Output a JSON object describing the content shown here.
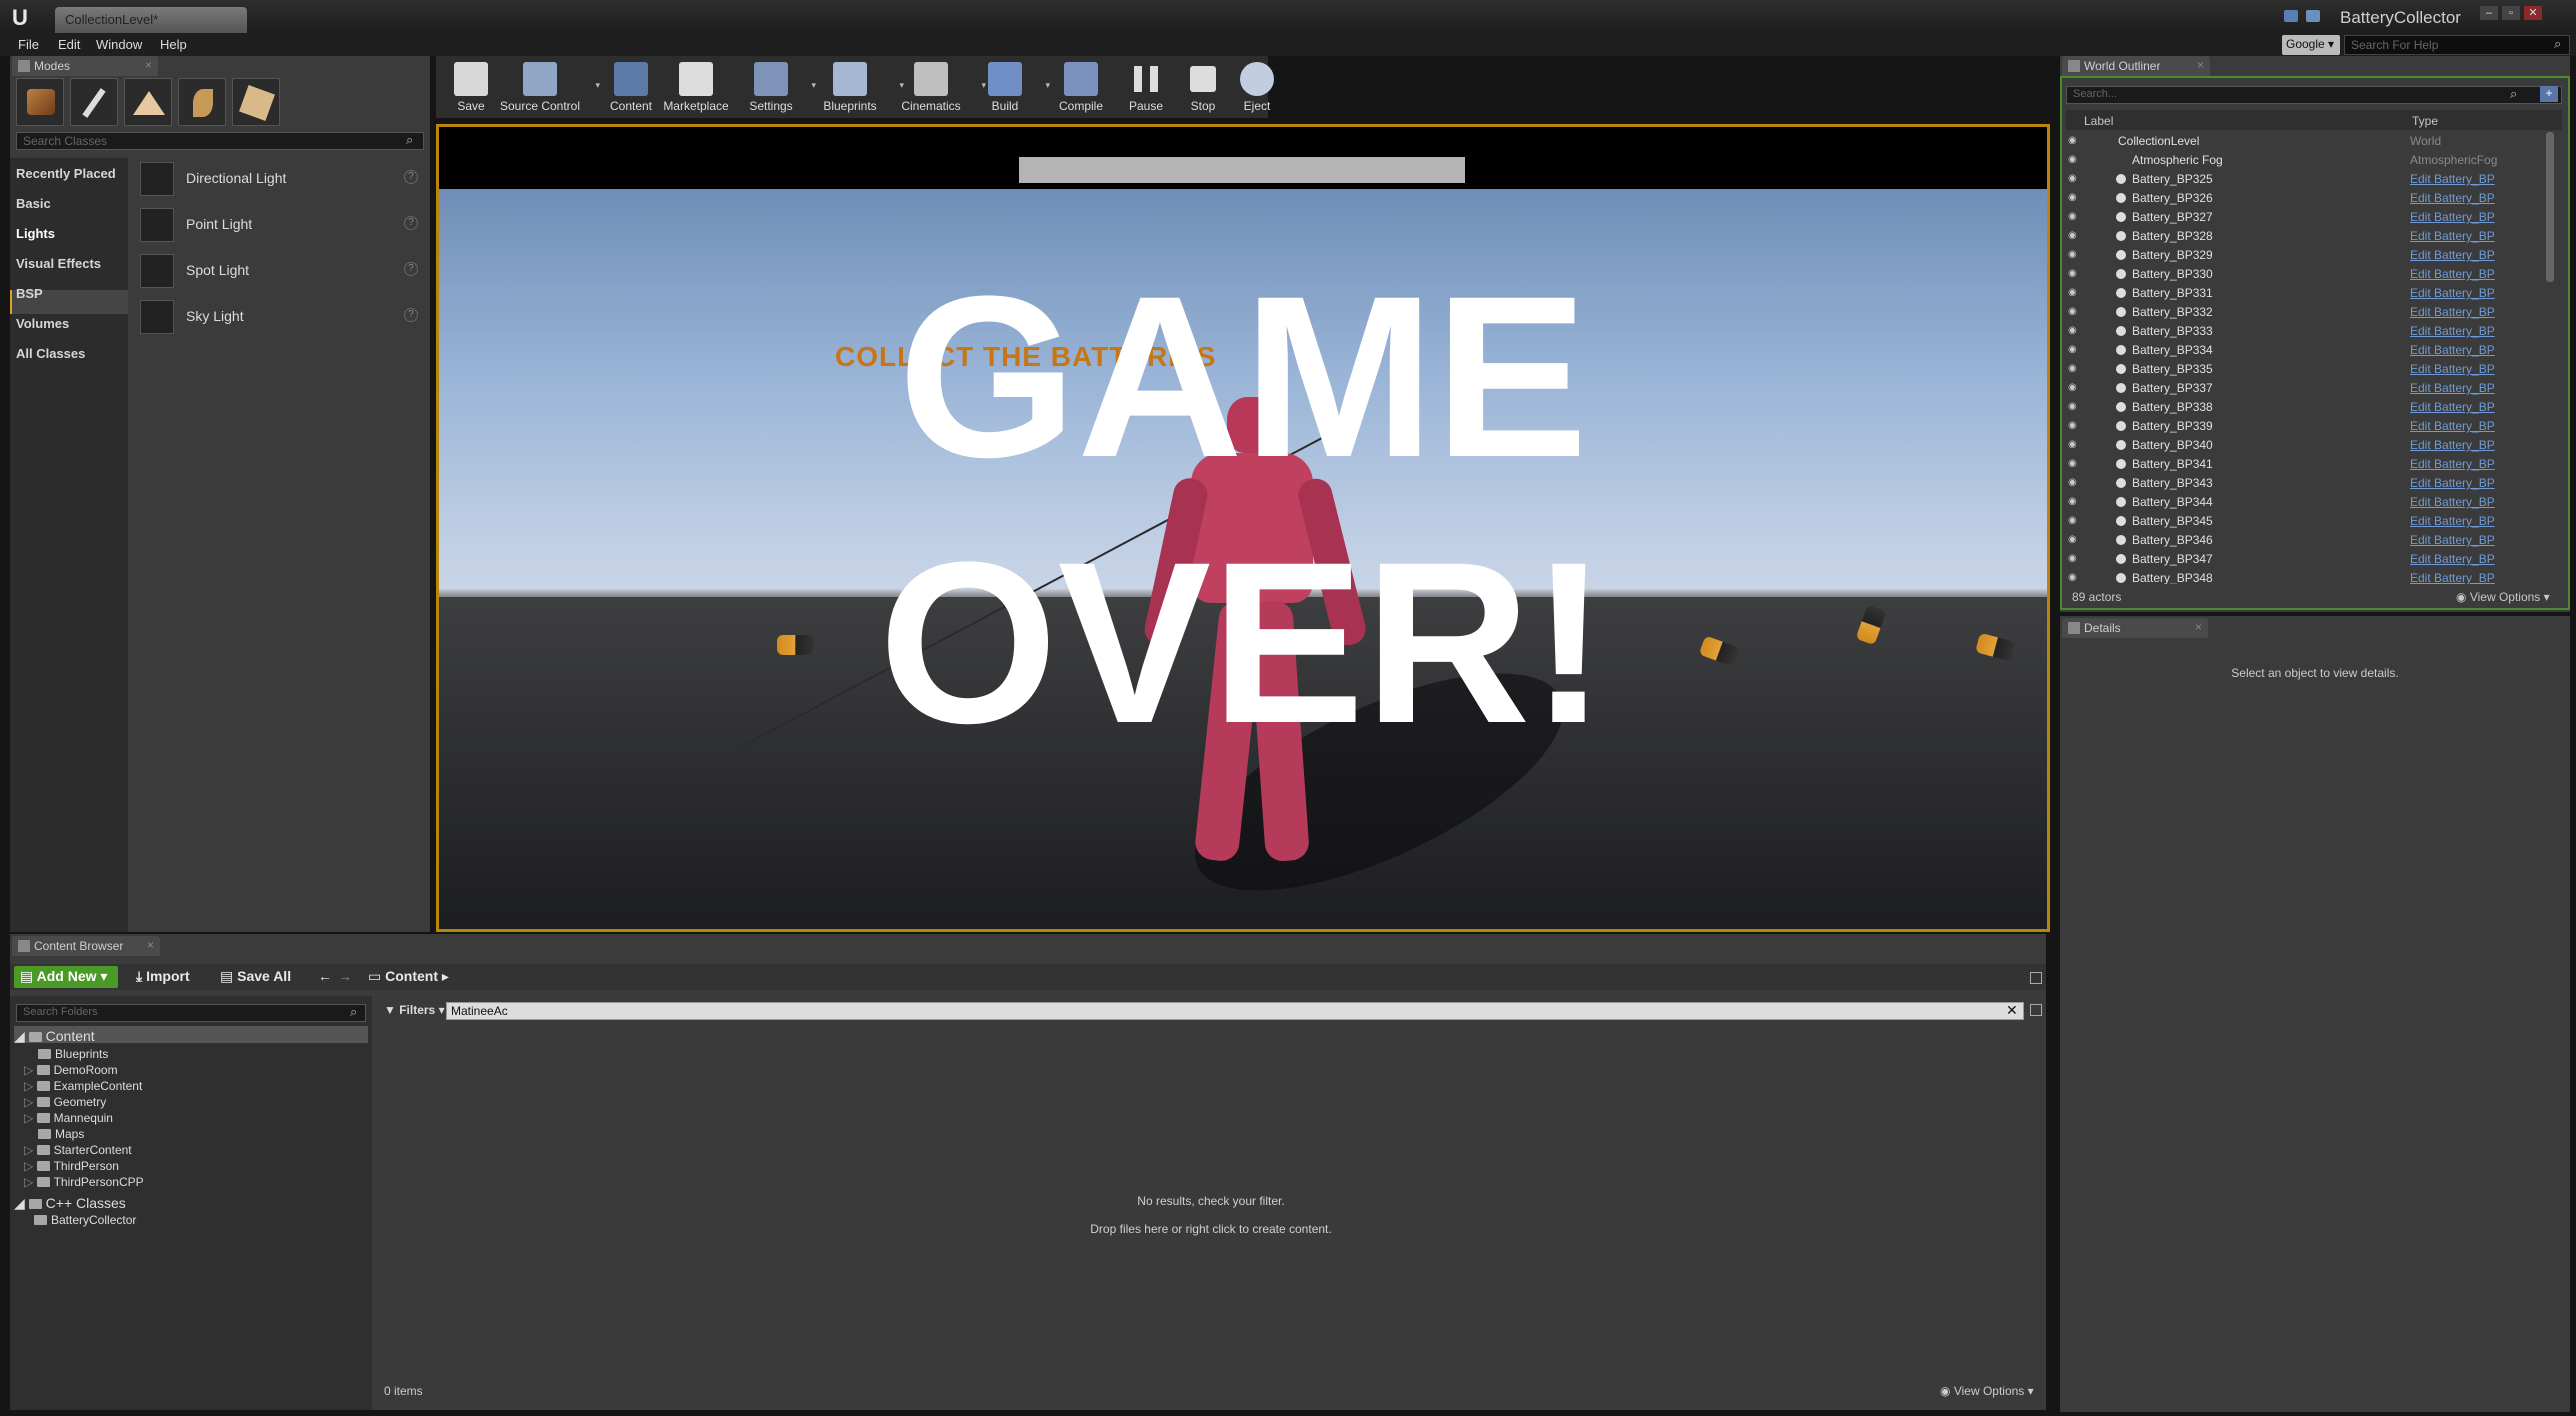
{
  "window": {
    "doc_tab": "CollectionLevel*",
    "project": "BatteryCollector",
    "menu": [
      "File",
      "Edit",
      "Window",
      "Help"
    ],
    "search_provider": "Google",
    "help_placeholder": "Search For Help"
  },
  "modes": {
    "tab": "Modes",
    "search_placeholder": "Search Classes",
    "categories": [
      "Recently Placed",
      "Basic",
      "Lights",
      "Visual Effects",
      "BSP",
      "Volumes",
      "All Classes"
    ],
    "selected_category": "Lights",
    "items": [
      "Directional Light",
      "Point Light",
      "Spot Light",
      "Sky Light"
    ]
  },
  "toolbar": {
    "buttons": [
      "Save",
      "Source Control",
      "Content",
      "Marketplace",
      "Settings",
      "Blueprints",
      "Cinematics",
      "Build",
      "Compile",
      "Pause",
      "Stop",
      "Eject"
    ]
  },
  "viewport": {
    "score_text": "COLLECT THE BATTERIES",
    "game_over_line1": "GAME",
    "game_over_line2": "OVER!"
  },
  "outliner": {
    "tab": "World Outliner",
    "search_placeholder": "Search...",
    "col_label": "Label",
    "col_type": "Type",
    "root": {
      "name": "CollectionLevel",
      "type": "World"
    },
    "fog": {
      "name": "Atmospheric Fog",
      "type": "AtmosphericFog"
    },
    "rows": [
      "Battery_BP325",
      "Battery_BP326",
      "Battery_BP327",
      "Battery_BP328",
      "Battery_BP329",
      "Battery_BP330",
      "Battery_BP331",
      "Battery_BP332",
      "Battery_BP333",
      "Battery_BP334",
      "Battery_BP335",
      "Battery_BP337",
      "Battery_BP338",
      "Battery_BP339",
      "Battery_BP340",
      "Battery_BP341",
      "Battery_BP343",
      "Battery_BP344",
      "Battery_BP345",
      "Battery_BP346",
      "Battery_BP347",
      "Battery_BP348"
    ],
    "row_type": "Edit Battery_BP",
    "count": "89 actors",
    "view_options": "View Options"
  },
  "details": {
    "tab": "Details",
    "message": "Select an object to view details."
  },
  "content_browser": {
    "tab": "Content Browser",
    "add_new": "Add New",
    "import": "Import",
    "save_all": "Save All",
    "path": "Content",
    "search_placeholder": "Search Folders",
    "tree_root": "Content",
    "folders": [
      "Blueprints",
      "DemoRoom",
      "ExampleContent",
      "Geometry",
      "Mannequin",
      "Maps",
      "StarterContent",
      "ThirdPerson",
      "ThirdPersonCPP"
    ],
    "cpp_root": "C++ Classes",
    "cpp_folders": [
      "BatteryCollector"
    ],
    "filters": "Filters",
    "filter_text": "MatineeAc",
    "no_results": "No results, check your filter.",
    "drop_hint": "Drop files here or right click to create content.",
    "items": "0 items",
    "view_options": "View Options"
  }
}
